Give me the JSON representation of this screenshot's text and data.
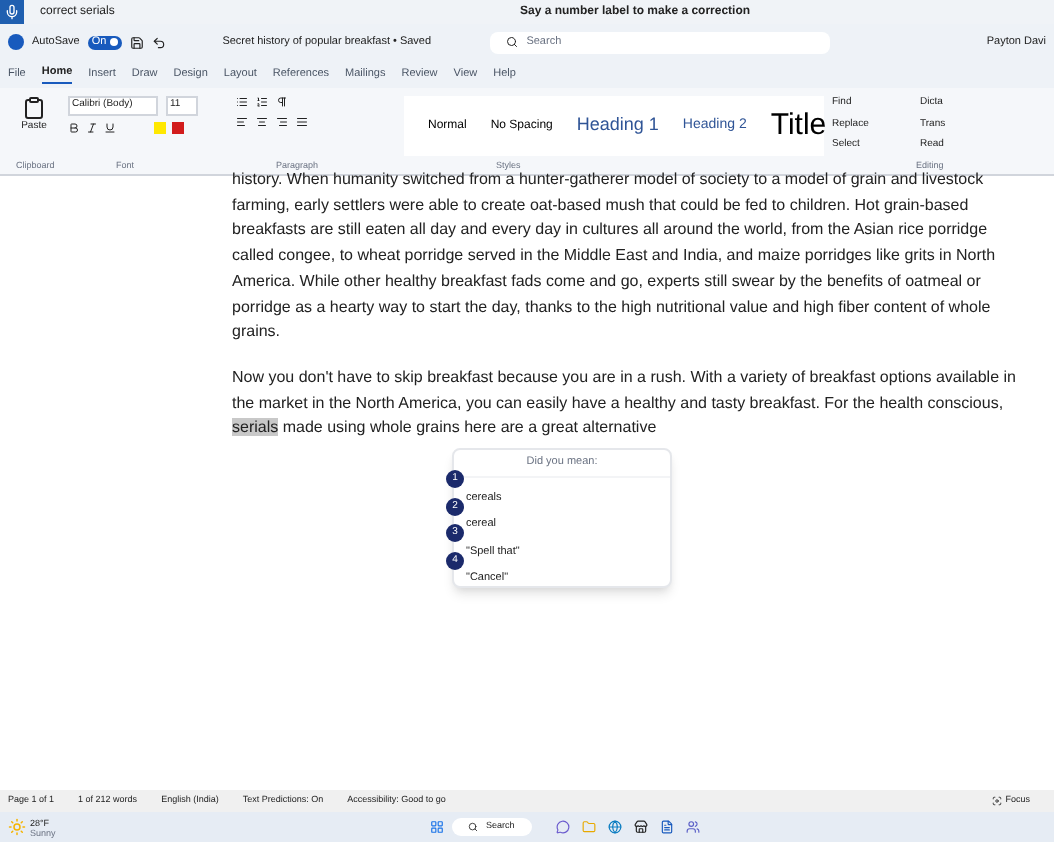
{
  "voice_bar": {
    "heard": "correct serials",
    "prompt": "Say a number label to make a correction"
  },
  "title_bar": {
    "autosave_label": "AutoSave",
    "autosave_on": true,
    "autosave_state": "On",
    "document_title": "Secret history of popular breakfast • Saved",
    "search_placeholder": "Search",
    "user": "Payton Davi"
  },
  "menu_tabs": [
    {
      "label": "File",
      "selected": false
    },
    {
      "label": "Home",
      "selected": true
    },
    {
      "label": "Insert",
      "selected": false
    },
    {
      "label": "Draw",
      "selected": false
    },
    {
      "label": "Design",
      "selected": false
    },
    {
      "label": "Layout",
      "selected": false
    },
    {
      "label": "References",
      "selected": false
    },
    {
      "label": "Mailings",
      "selected": false
    },
    {
      "label": "Review",
      "selected": false
    },
    {
      "label": "View",
      "selected": false
    },
    {
      "label": "Help",
      "selected": false
    }
  ],
  "ribbon": {
    "paste": "Paste",
    "font": "Calibri (Body)",
    "size": "11",
    "styles": [
      {
        "label": "Normal",
        "kind": "normal"
      },
      {
        "label": "No Spacing",
        "kind": "normal"
      },
      {
        "label": "Heading 1",
        "kind": "heading1"
      },
      {
        "label": "Heading 2",
        "kind": "heading2"
      },
      {
        "label": "Title",
        "kind": "title"
      }
    ],
    "editing": [
      "Find",
      "Replace",
      "Select"
    ],
    "voice": [
      "Dicta",
      "Trans",
      "Read"
    ],
    "groups": [
      "Clipboard",
      "Font",
      "Paragraph",
      "Styles",
      "Editing"
    ]
  },
  "document": {
    "paragraphs": [
      "history. When humanity switched from a hunter-gatherer model of society to a model of grain and livestock farming, early settlers were able to create oat-based mush that could be fed to children. Hot grain-based breakfasts are still eaten all day and every day in cultures all around the world, from the Asian rice porridge called congee, to wheat porridge served in the Middle East and India, and maize porridges like grits in North America. While other healthy breakfast fads come and go, experts still swear by the benefits of oatmeal or porridge as a hearty way to start the day, thanks to the high nutritional value and high fiber content of whole grains.",
      "Now you don't have to skip breakfast because you are in a rush. With a variety of breakfast options available in the market in the North America, you can easily have a healthy and tasty breakfast. For the health conscious,"
    ],
    "highlighted_word": "serials",
    "after_highlight": "made using whole grains here are a great alternative"
  },
  "correction_popup": {
    "title": "Did you mean:",
    "options": [
      {
        "number": "1",
        "label": "cereals"
      },
      {
        "number": "2",
        "label": "cereal"
      },
      {
        "number": "3",
        "label": "\"Spell that\""
      },
      {
        "number": "4",
        "label": "\"Cancel\""
      }
    ]
  },
  "status_bar": {
    "items": [
      "Page 1 of 1",
      "1 of 212 words",
      "English (India)",
      "Text Predictions: On",
      "Accessibility: Good to go"
    ],
    "focus": "Focus"
  },
  "taskbar": {
    "temperature": "28°F",
    "weather": "Sunny",
    "search": "Search"
  }
}
